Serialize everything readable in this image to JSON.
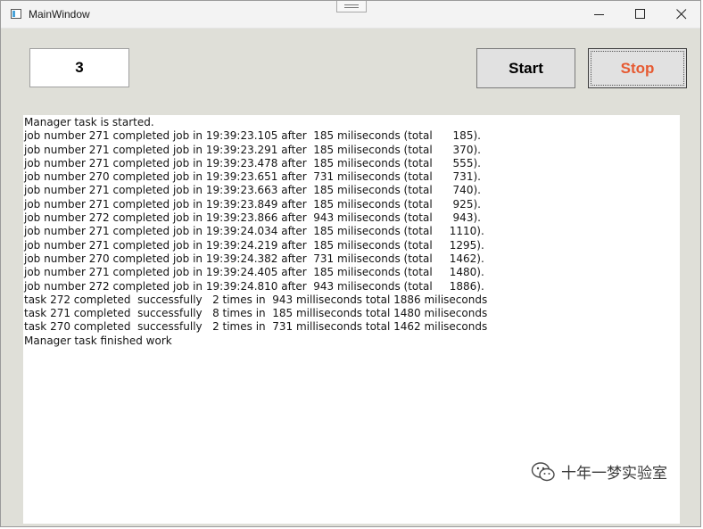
{
  "window": {
    "title": "MainWindow"
  },
  "toolbar": {
    "count_value": "3",
    "start_label": "Start",
    "stop_label": "Stop",
    "stop_color": "#e65a32"
  },
  "log": {
    "lines": [
      "Manager task is started.",
      "job number 271 completed job in 19:39:23.105 after  185 miliseconds (total      185).",
      "job number 271 completed job in 19:39:23.291 after  185 miliseconds (total      370).",
      "job number 271 completed job in 19:39:23.478 after  185 miliseconds (total      555).",
      "job number 270 completed job in 19:39:23.651 after  731 miliseconds (total      731).",
      "job number 271 completed job in 19:39:23.663 after  185 miliseconds (total      740).",
      "job number 271 completed job in 19:39:23.849 after  185 miliseconds (total      925).",
      "job number 272 completed job in 19:39:23.866 after  943 miliseconds (total      943).",
      "job number 271 completed job in 19:39:24.034 after  185 miliseconds (total     1110).",
      "job number 271 completed job in 19:39:24.219 after  185 miliseconds (total     1295).",
      "job number 270 completed job in 19:39:24.382 after  731 miliseconds (total     1462).",
      "job number 271 completed job in 19:39:24.405 after  185 miliseconds (total     1480).",
      "job number 272 completed job in 19:39:24.810 after  943 miliseconds (total     1886).",
      "task 272 completed  successfully   2 times in  943 milliseconds total 1886 miliseconds",
      "task 271 completed  successfully   8 times in  185 milliseconds total 1480 miliseconds",
      "task 270 completed  successfully   2 times in  731 milliseconds total 1462 miliseconds",
      "Manager task finished work"
    ]
  },
  "watermark": {
    "text": "十年一梦实验室",
    "icon": "wechat-icon"
  }
}
